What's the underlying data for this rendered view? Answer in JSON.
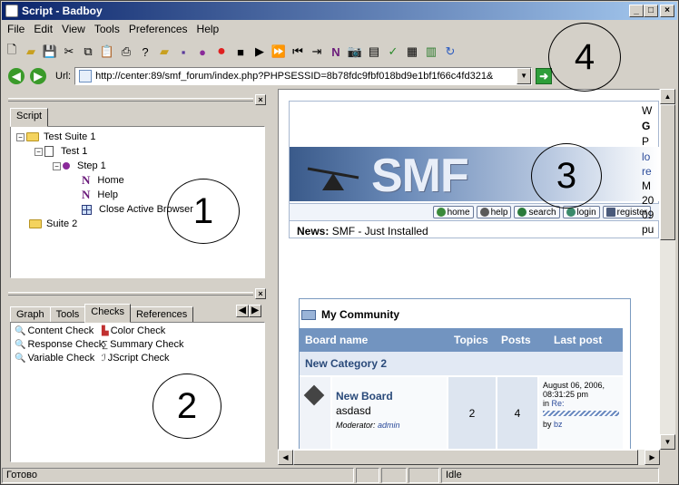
{
  "window": {
    "title": "Script - Badboy",
    "min": "_",
    "max": "□",
    "close": "×"
  },
  "menu": [
    {
      "label": "File",
      "key": "F"
    },
    {
      "label": "Edit",
      "key": "E"
    },
    {
      "label": "View",
      "key": "V"
    },
    {
      "label": "Tools",
      "key": "T"
    },
    {
      "label": "Preferences",
      "key": "P"
    },
    {
      "label": "Help",
      "key": "H"
    }
  ],
  "address": {
    "label": "Url:",
    "value": "http://center:89/smf_forum/index.php?PHPSESSID=8b78fdc9fbf018bd9e1bf1f66c4fd321&"
  },
  "script_panel": {
    "tab": "Script",
    "tree": {
      "suite1": "Test Suite 1",
      "test1": "Test 1",
      "step1": "Step 1",
      "home": "Home",
      "help": "Help",
      "close_browser": "Close Active Browser",
      "suite2": "Suite 2"
    }
  },
  "tools_panel": {
    "tabs": [
      "Graph",
      "Tools",
      "Checks",
      "References"
    ],
    "active_tab": "Checks",
    "checks": [
      "Content Check",
      "Color Check",
      "Response Check",
      "Summary Check",
      "Variable Check",
      "JScript Check"
    ]
  },
  "callouts": [
    "1",
    "2",
    "3",
    "4"
  ],
  "browser": {
    "logo": "SMF",
    "links": [
      "home",
      "help",
      "search",
      "login",
      "register"
    ],
    "news_label": "News:",
    "news_text": "SMF - Just Installed",
    "right_col": [
      "W",
      "G",
      "P",
      "lo",
      "re",
      "M",
      "20",
      "09",
      "pu"
    ],
    "community": "My Community",
    "table_headers": [
      "Board name",
      "Topics",
      "Posts",
      "Last post"
    ],
    "category": "New Category 2",
    "board": {
      "name": "New Board",
      "desc": "asdasd",
      "moderator_label": "Moderator:",
      "moderator": "admin",
      "topics": "2",
      "posts": "4"
    },
    "last_post": {
      "date": "August 06, 2006,",
      "time": "08:31:25 pm",
      "in_label": "in",
      "in_link": "Re:",
      "by_label": "by",
      "by": "bz"
    }
  },
  "status": {
    "left": "Готово",
    "state": "Idle"
  }
}
